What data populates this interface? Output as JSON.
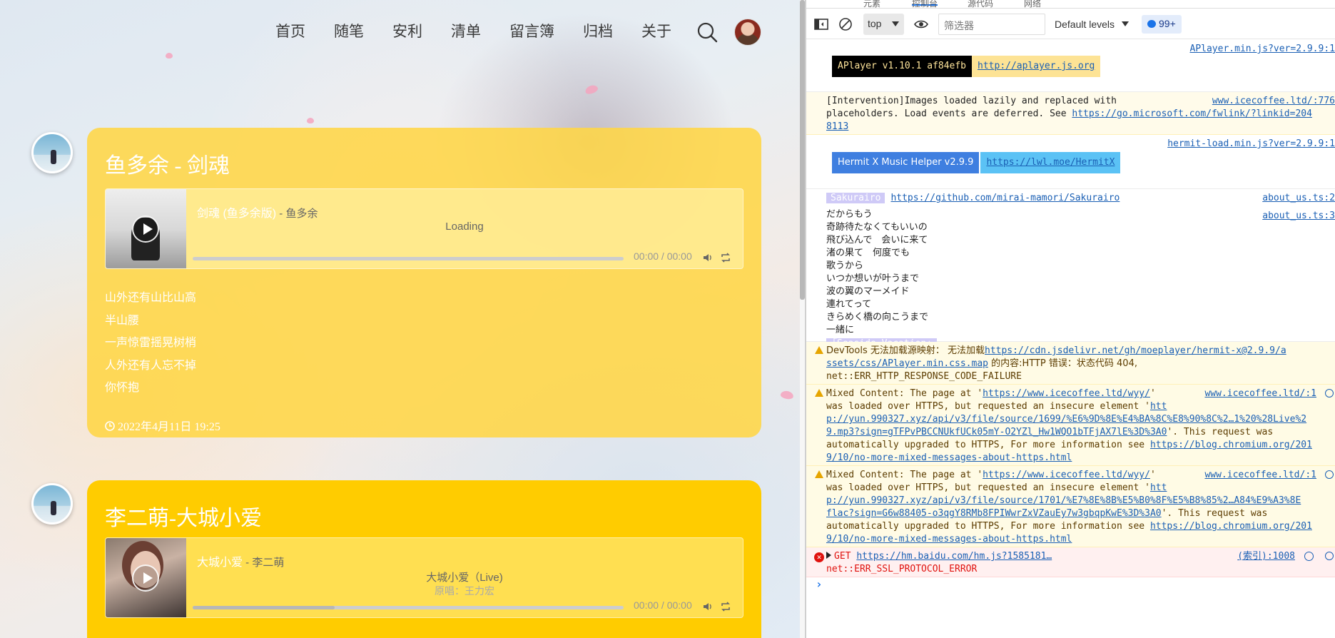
{
  "blog": {
    "nav": [
      "首页",
      "随笔",
      "安利",
      "清单",
      "留言簿",
      "归档",
      "关于"
    ],
    "posts": [
      {
        "title": "鱼多余 - 剑魂",
        "song_title": "剑魂 (鱼多余版)",
        "song_artist": " - 鱼多余",
        "lyric_status": "Loading",
        "time": "00:00 / 00:00",
        "progress": 0,
        "lyrics": [
          "山外还有山比山高",
          "半山腰",
          "一声惊雷摇晃树梢",
          "人外还有人忘不掉",
          "你怀抱"
        ],
        "date": "2022年4月11日 19:25"
      },
      {
        "title": "李二萌-大城小爱",
        "song_title": "大城小爱",
        "song_artist": " - 李二萌",
        "lyric_status": "大城小爱（Live)",
        "lyric_sub": "原唱：王力宏",
        "time": "00:00 / 00:00",
        "progress": 0.33
      }
    ]
  },
  "devtools": {
    "tabs_partial": [
      "元素",
      "控制台",
      "源代码",
      "网络"
    ],
    "context": "top",
    "filter_placeholder": "筛选器",
    "levels": "Default levels",
    "issues": "99+",
    "messages": {
      "aplayer_src": "APlayer.min.js?ver=2.9.9:1",
      "aplayer_badge": "APlayer v1.10.1 af84efb",
      "aplayer_link": "http://aplayer.js.org",
      "intervention_src": "www.icecoffee.ltd/:776",
      "intervention_l1": "[Intervention]Images loaded lazily and replaced with",
      "intervention_l2a": "placeholders. Load events are deferred. See ",
      "intervention_l2b": "https://go.microsoft.com/fwlink/?linkid=204",
      "intervention_l3": "8113",
      "hermit_src": "hermit-load.min.js?ver=2.9.9:1",
      "hermit_badge": "Hermit X Music Helper v2.9.9",
      "hermit_link": "https://lwl.moe/HermitX",
      "sakurairo_badge": "Sakurairo",
      "sakurairo_link": "https://github.com/mirai-mamori/Sakurairo",
      "sakurairo_src": "about_us.ts:2",
      "lyrics_src": "about_us.ts:3",
      "jp_lyrics": [
        "だからもう",
        "奇跡待たなくてもいいの",
        "飛び込んで　会いに来て",
        "渚の果て　何度でも",
        "歌うから",
        "いつか想いが叶うまで",
        "波の翼のマーメイド",
        "連れてって",
        "きらめく橋の向こうまで",
        "一緒に"
      ],
      "seaside": "「Seaside Vacation」",
      "sourcemap_l1a": "DevTools 无法加载源映射： 无法加载",
      "sourcemap_l1b": "https://cdn.jsdelivr.net/gh/moeplayer/hermit-x@2.9.9/a",
      "sourcemap_l2a": "ssets/css/APlayer.min.css.map",
      "sourcemap_l2b": " 的内容:HTTP 错误：状态代码 404,",
      "sourcemap_l3": "net::ERR_HTTP_RESPONSE_CODE_FAILURE",
      "mixed1_src": "www.icecoffee.ltd/:1",
      "mixed1_l1a": "Mixed Content: The page at '",
      "mixed1_l1b": "https://www.icecoffee.ltd/wyy/",
      "mixed1_l1c": "'",
      "mixed1_l2a": "was loaded over HTTPS, but requested an insecure element '",
      "mixed1_l2b": "htt",
      "mixed1_l3": "p://yun.990327.xyz/api/v3/file/source/1699/%E6%9D%8E%E4%BA%8C%E8%90%8C%2…1%20%28Live%2",
      "mixed1_l4a": "9.mp3?sign=gTFPvPBCCNUkfUCk05mY-O2YZl_Hw1WQO1bTFjAX7lE%3D%3A0",
      "mixed1_l4b": "'. This request was",
      "mixed1_l5a": "automatically upgraded to HTTPS, For more information see ",
      "mixed1_l5b": "https://blog.chromium.org/201",
      "mixed1_l6": "9/10/no-more-mixed-messages-about-https.html",
      "mixed2_src": "www.icecoffee.ltd/:1",
      "mixed2_l3": "p://yun.990327.xyz/api/v3/file/source/1701/%E7%8E%8B%E5%B0%8F%E5%B8%85%2…A84%E9%A3%8E",
      "mixed2_l4a": "flac?sign=G6w88405-o3qgY8RMb8FPIWwrZxVZauEy7w3gbqpKwE%3D%3A0",
      "mixed2_l4b": "'. This request was",
      "err_src": "(索引):1008",
      "err_l1a": "GET ",
      "err_l1b": "https://hm.baidu.com/hm.js?1585181…",
      "err_l2": "net::ERR_SSL_PROTOCOL_ERROR",
      "prompt": "›"
    }
  }
}
